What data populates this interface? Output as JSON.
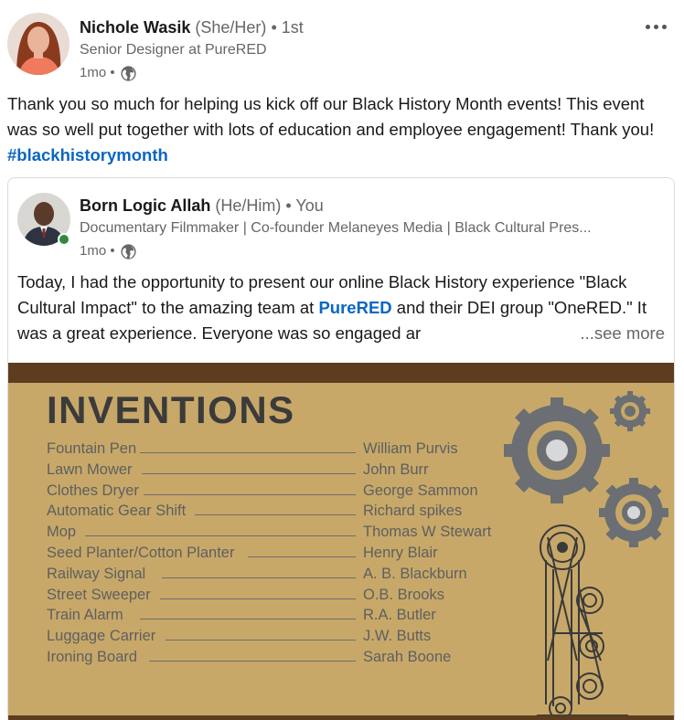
{
  "author": {
    "name": "Nichole Wasik",
    "pronouns": "(She/Her)",
    "degree": "• 1st",
    "headline": "Senior Designer at PureRED",
    "time": "1mo •",
    "visibility_icon": "globe-icon"
  },
  "post": {
    "text": "Thank you so much for helping us kick off our Black History Month events! This event was so well put together with lots of education and employee engagement! Thank you! ",
    "hashtag": "#blackhistorymonth"
  },
  "menu_icon": "more-horizontal-icon",
  "shared_post": {
    "author": {
      "name": "Born Logic Allah",
      "pronouns": "(He/Him)",
      "degree": "• You",
      "headline": "Documentary Filmmaker | Co-founder Melaneyes Media | Black Cultural Pres...",
      "time": "1mo •",
      "status": "online"
    },
    "text_before": "Today, I had the opportunity to present our online Black History experience \"Black Cultural Impact\" to the amazing team at ",
    "mention": "PureRED",
    "text_after": " and their DEI group \"OneRED.\" It was a great experience. Everyone was so engaged ar",
    "see_more": "...see more"
  },
  "graphic": {
    "title": "INVENTIONS",
    "rows": [
      {
        "item": "Fountain Pen",
        "inventor": "William Purvis"
      },
      {
        "item": "Lawn Mower",
        "inventor": "John Burr"
      },
      {
        "item": "Clothes Dryer",
        "inventor": "George Sammon"
      },
      {
        "item": "Automatic Gear Shift",
        "inventor": "Richard spikes"
      },
      {
        "item": "Mop",
        "inventor": "Thomas W Stewart"
      },
      {
        "item": "Seed Planter/Cotton Planter",
        "inventor": "Henry Blair"
      },
      {
        "item": "Railway Signal",
        "inventor": "A. B. Blackburn"
      },
      {
        "item": "Street Sweeper",
        "inventor": "O.B. Brooks"
      },
      {
        "item": "Train Alarm",
        "inventor": "R.A. Butler"
      },
      {
        "item": "Luggage Carrier",
        "inventor": "J.W. Butts"
      },
      {
        "item": "Ironing Board",
        "inventor": "Sarah Boone"
      }
    ],
    "colors": {
      "background": "#c7a869",
      "bar": "#5c3d20",
      "gear": "#6b6e72"
    }
  }
}
